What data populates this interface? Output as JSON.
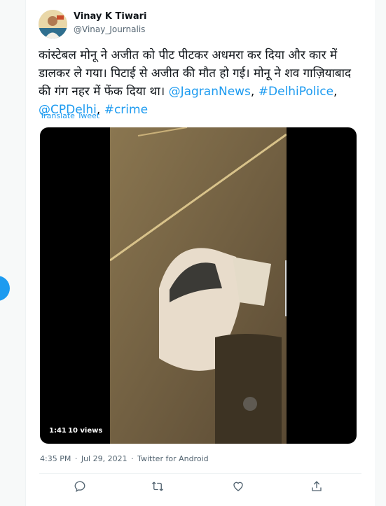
{
  "tweet": {
    "author_name": "Vinay K Tiwari",
    "author_handle": "@Vinay_Journalis",
    "text_plain": "कांस्टेबल मोनू ने अजीत को पीट पीटकर अधमरा कर दिया और कार में डालकर ले गया। पिटाई से  अजीत की मौत हो गई। मोनू ने शव गाज़ियाबाद की गंग नहर में फेंक दिया था। ",
    "mention_1": "@JagranNews",
    "sep_1": ",",
    "hashtag_1": "#DelhiPolice",
    "sep_2": ",",
    "mention_2": "@CPDelhi",
    "sep_3": ",",
    "hashtag_2": "#crime",
    "translate_label": "Translate Tweet",
    "video_time": "1:41",
    "video_views": "10 views",
    "timestamp_time": "4:35 PM",
    "separator": "·",
    "timestamp_date": "Jul 29, 2021",
    "source": "Twitter for Android"
  },
  "actions": {
    "reply_icon": "reply-icon",
    "retweet_icon": "retweet-icon",
    "like_icon": "heart-icon",
    "share_icon": "share-icon"
  },
  "colors": {
    "link": "#1d9bf0",
    "secondary_text": "#536471",
    "primary_text": "#0f1419"
  }
}
